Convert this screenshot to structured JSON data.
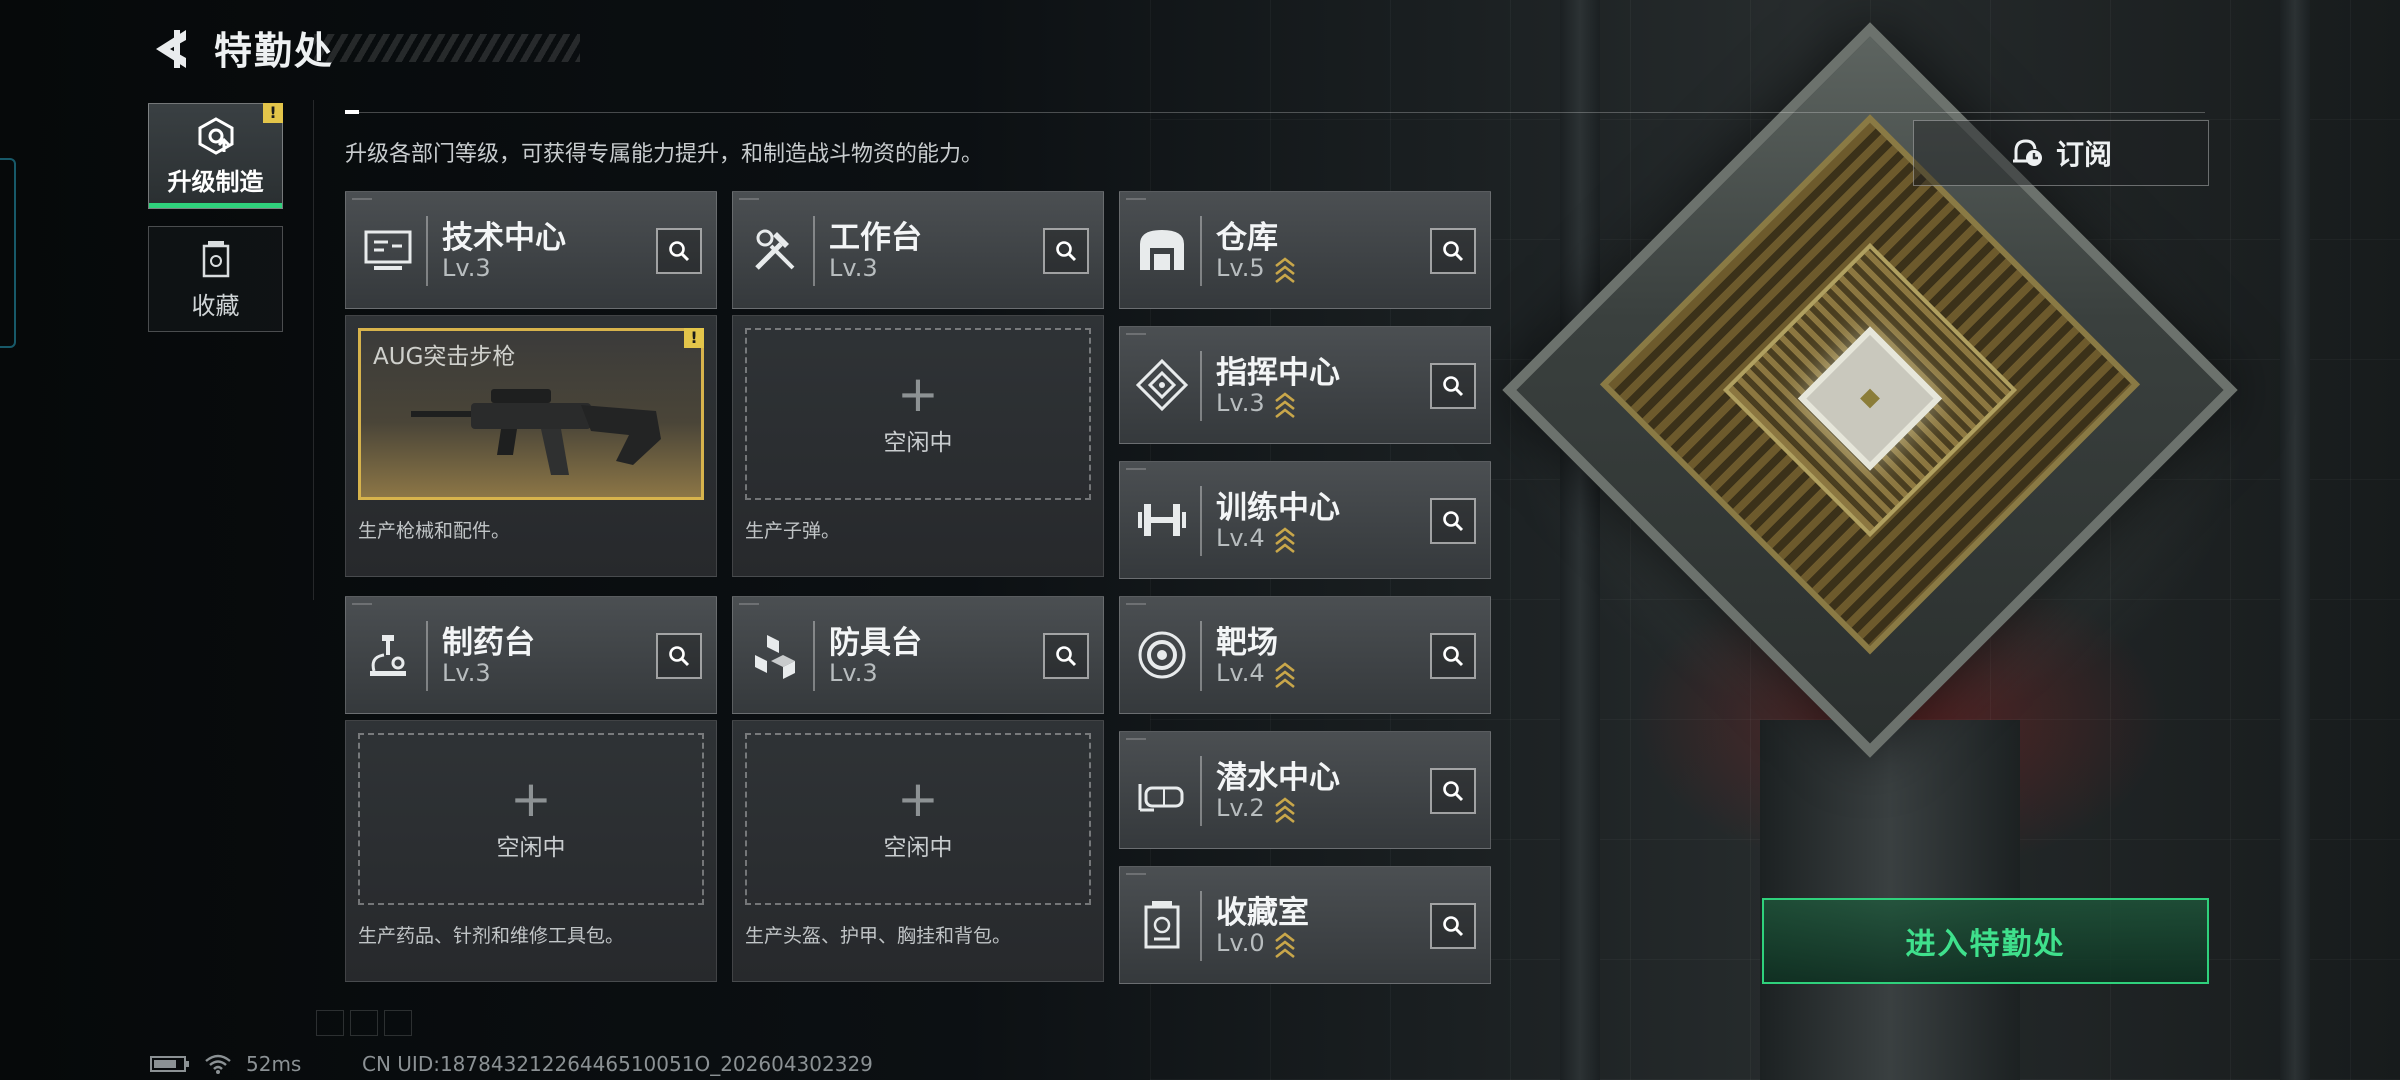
{
  "header": {
    "title": "特勤处"
  },
  "description": "升级各部门等级，可获得专属能力提升，和制造战斗物资的能力。",
  "sidebar": {
    "items": [
      {
        "label": "升级制造",
        "icon": "upgrade-gear-icon",
        "active": true,
        "alert": "!"
      },
      {
        "label": "收藏",
        "icon": "collection-case-icon",
        "active": false
      }
    ]
  },
  "departments": {
    "tech_center": {
      "name": "技术中心",
      "level": "Lv.3",
      "icon": "monitor-icon",
      "upgradable": false
    },
    "workbench": {
      "name": "工作台",
      "level": "Lv.3",
      "icon": "tools-icon",
      "upgradable": false
    },
    "pharmacy": {
      "name": "制药台",
      "level": "Lv.3",
      "icon": "microscope-icon",
      "upgradable": false
    },
    "armor_bench": {
      "name": "防具台",
      "level": "Lv.3",
      "icon": "cubes-icon",
      "upgradable": false
    },
    "warehouse": {
      "name": "仓库",
      "level": "Lv.5",
      "icon": "warehouse-icon",
      "upgradable": true
    },
    "command": {
      "name": "指挥中心",
      "level": "Lv.3",
      "icon": "command-diamond-icon",
      "upgradable": true
    },
    "training": {
      "name": "训练中心",
      "level": "Lv.4",
      "icon": "dumbbell-icon",
      "upgradable": true
    },
    "range": {
      "name": "靶场",
      "level": "Lv.4",
      "icon": "target-icon",
      "upgradable": true
    },
    "diving": {
      "name": "潜水中心",
      "level": "Lv.2",
      "icon": "diving-mask-icon",
      "upgradable": true
    },
    "collection": {
      "name": "收藏室",
      "level": "Lv.0",
      "icon": "collection-room-icon",
      "upgradable": true
    }
  },
  "production": {
    "tech_center": {
      "item": "AUG突击步枪",
      "alert": "!",
      "desc": "生产枪械和配件。"
    },
    "workbench": {
      "slot": "空闲中",
      "desc": "生产子弹。"
    },
    "pharmacy": {
      "slot": "空闲中",
      "desc": "生产药品、针剂和维修工具包。"
    },
    "armor_bench": {
      "slot": "空闲中",
      "desc": "生产头盔、护甲、胸挂和背包。"
    }
  },
  "subscribe": {
    "label": "订阅",
    "icon": "bell-clock-icon"
  },
  "enter_button": {
    "label": "进入特勤处"
  },
  "status_bar": {
    "ping": "52ms",
    "uid": "CN UID:18784321226446510051O_202604302329"
  },
  "colors": {
    "accent_green": "#2fd17c",
    "gold": "#d7b34c",
    "alert_yellow": "#e3c54a"
  }
}
